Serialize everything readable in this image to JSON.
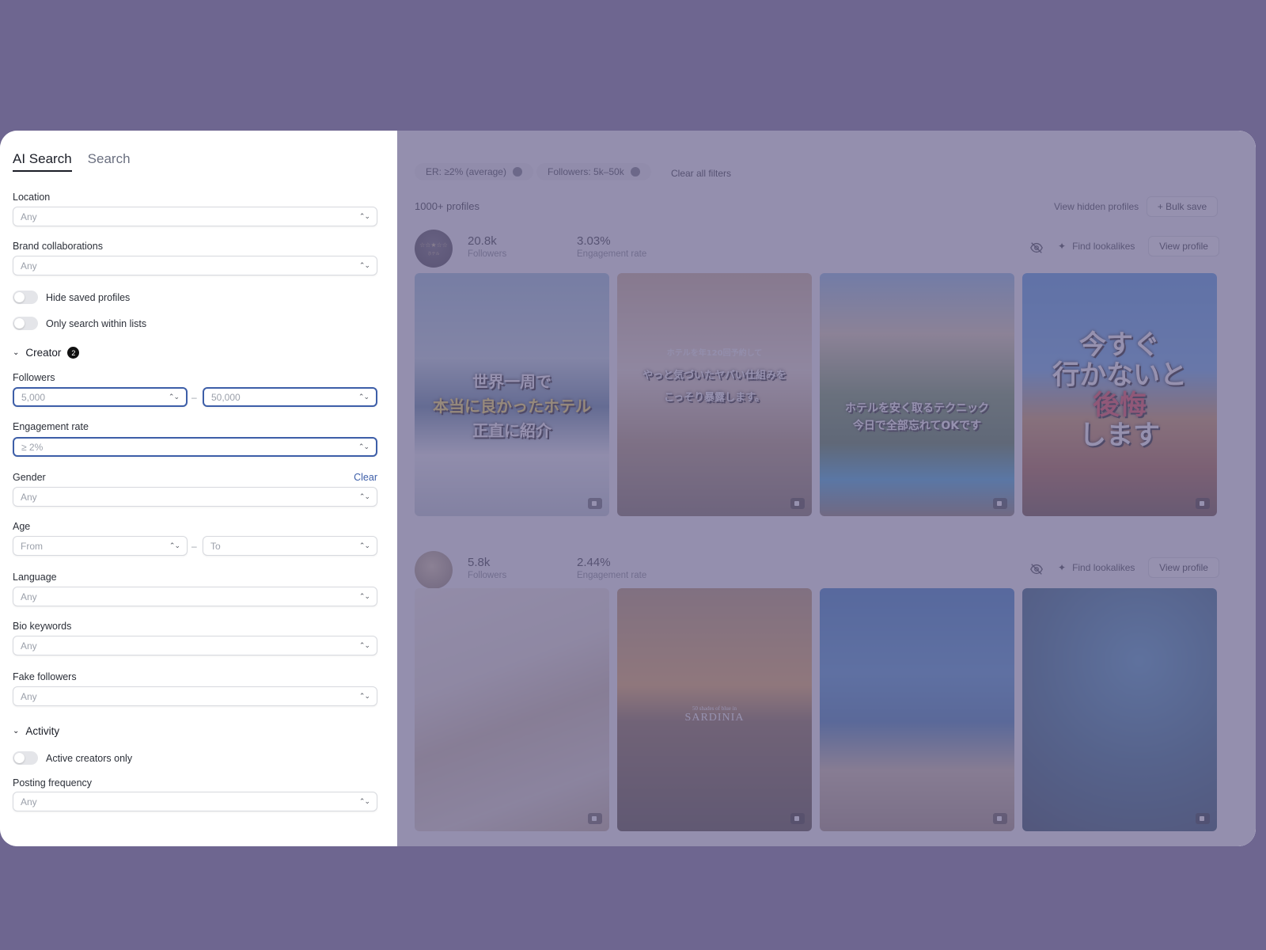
{
  "tabs": {
    "ai_search": "AI Search",
    "search": "Search"
  },
  "filters": {
    "location": {
      "label": "Location",
      "value": "Any"
    },
    "brand": {
      "label": "Brand collaborations",
      "value": "Any"
    },
    "hide_saved": "Hide saved profiles",
    "only_lists": "Only search within lists",
    "creator": {
      "label": "Creator",
      "badge": "2"
    },
    "followers": {
      "label": "Followers",
      "min": "5,000",
      "max": "50,000",
      "sep": "–"
    },
    "engagement": {
      "label": "Engagement rate",
      "value": "≥ 2%"
    },
    "gender": {
      "label": "Gender",
      "value": "Any",
      "clear": "Clear"
    },
    "age": {
      "label": "Age",
      "from": "From",
      "to": "To",
      "sep": "–"
    },
    "language": {
      "label": "Language",
      "value": "Any"
    },
    "bio": {
      "label": "Bio keywords",
      "value": "Any"
    },
    "fake": {
      "label": "Fake followers",
      "value": "Any"
    },
    "activity": {
      "label": "Activity"
    },
    "active_only": "Active creators only",
    "posting": {
      "label": "Posting frequency",
      "value": "Any"
    }
  },
  "main": {
    "chips": [
      "ER: ≥2% (average)",
      "Followers: 5k–50k"
    ],
    "clear_all": "Clear all filters",
    "count": "1000+ profiles",
    "view_hidden": "View hidden profiles",
    "bulk_save": "+ Bulk save",
    "find_lookalikes": "Find lookalikes",
    "view_profile": "View profile",
    "profiles": [
      {
        "followers": "20.8k",
        "followers_label": "Followers",
        "er": "3.03%",
        "er_label": "Engagement rate",
        "captions": [
          [
            "世界一周で",
            "本当に良かったホテル",
            "正直に紹介"
          ],
          [
            "ホテルを年120回予約して",
            "やっと気づいたヤバい仕組みを",
            "こっそり暴露します。"
          ],
          [
            "ホテルを安く取るテクニック",
            "今日で全部忘れてOKです"
          ],
          [
            "今すぐ",
            "行かないと",
            "後悔",
            "します"
          ]
        ]
      },
      {
        "followers": "5.8k",
        "followers_label": "Followers",
        "er": "2.44%",
        "er_label": "Engagement rate",
        "captions": [
          [],
          [
            "50 shades of blue in",
            "SARDINIA"
          ],
          [],
          []
        ]
      }
    ]
  }
}
